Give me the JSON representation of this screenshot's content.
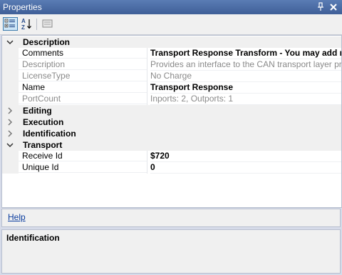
{
  "window": {
    "title": "Properties",
    "pin_icon": "pin-icon",
    "close_icon": "close-icon"
  },
  "toolbar": {
    "categorized_icon": "categorized-view-icon",
    "alphabetical_icon": "alphabetical-sort-icon",
    "property_pages_icon": "property-pages-icon",
    "alpha_glyph_top": "A",
    "alpha_glyph_bottom": "Z"
  },
  "grid": {
    "categories": [
      {
        "label": "Description",
        "expanded": true
      },
      {
        "label": "Editing",
        "expanded": false
      },
      {
        "label": "Execution",
        "expanded": false
      },
      {
        "label": "Identification",
        "expanded": false
      },
      {
        "label": "Transport",
        "expanded": true
      }
    ],
    "description_props": [
      {
        "name": "Comments",
        "value": "Transport Response Transform - You may add r"
      },
      {
        "name": "Description",
        "value": "Provides an interface to the CAN transport layer protocol"
      },
      {
        "name": "LicenseType",
        "value": "No Charge"
      },
      {
        "name": "Name",
        "value": "Transport Response"
      },
      {
        "name": "PortCount",
        "value": "Inports: 2, Outports: 1"
      }
    ],
    "transport_props": [
      {
        "name": "Receive Id",
        "value": "$720"
      },
      {
        "name": "Unique Id",
        "value": "0"
      }
    ]
  },
  "help": {
    "link_text": "Help"
  },
  "description_pane": {
    "title": "Identification"
  },
  "colors": {
    "titlebar": "#4d6fa8",
    "link": "#0b3d9e",
    "readonly_text": "#8a8a8a"
  }
}
